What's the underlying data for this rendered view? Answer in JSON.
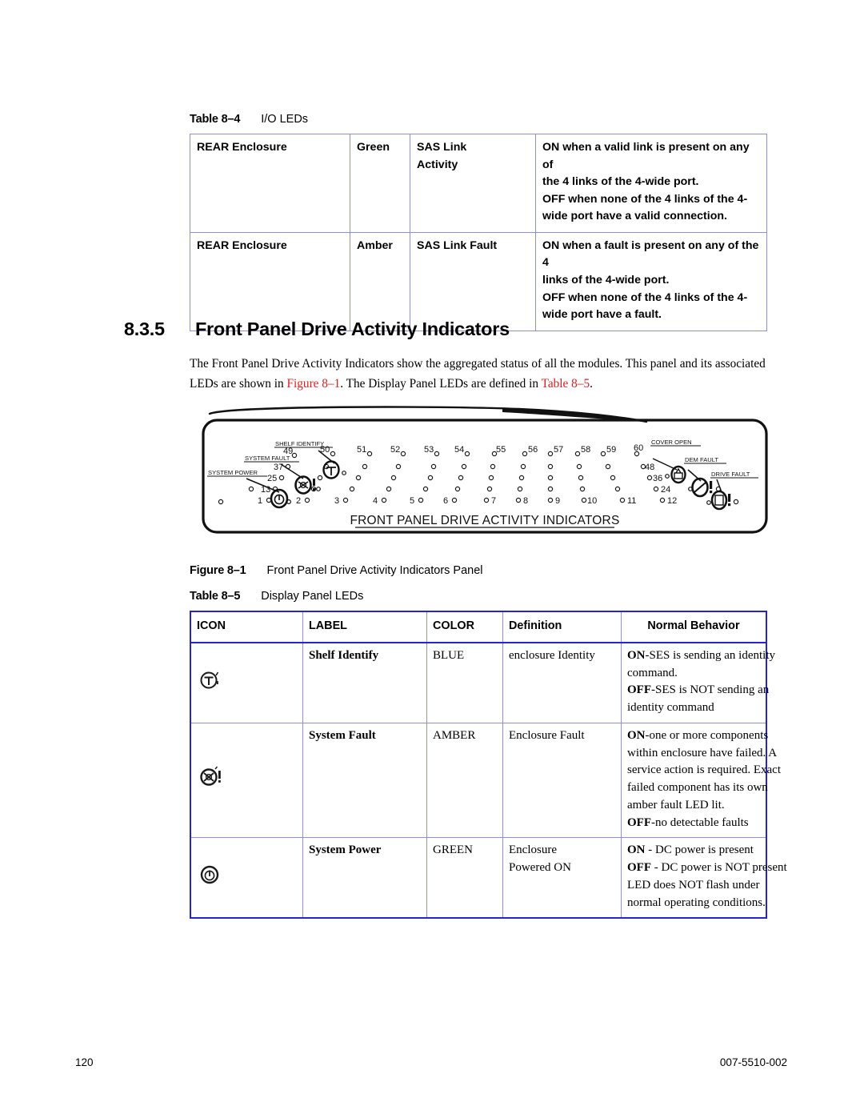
{
  "table_84": {
    "caption_label": "Table 8–4",
    "caption_text": "I/O LEDs",
    "rows": [
      {
        "enclosure": "REAR Enclosure",
        "color": "Green",
        "label_lines": [
          "SAS Link",
          "Activity"
        ],
        "behavior_lines": [
          "ON when a valid link is present on any of",
          "the 4 links of the 4-wide port.",
          "OFF when none of the 4 links of the 4-",
          "wide port have a valid connection."
        ]
      },
      {
        "enclosure": "REAR Enclosure",
        "color": "Amber",
        "label_lines": [
          "SAS Link Fault"
        ],
        "behavior_lines": [
          "ON when a fault is present on any of the 4",
          "links of the 4-wide port.",
          "OFF when none of the 4 links of the 4-",
          "wide port have a fault."
        ]
      }
    ]
  },
  "section": {
    "number": "8.3.5",
    "title": "Front Panel Drive Activity Indicators",
    "paragraph_part1": "The Front  Panel Drive Activity Indicators show the aggregated status of all the modules. This panel and its associated LEDs are shown in ",
    "xref_figure": "Figure 8–1",
    "paragraph_part2": ". The Display Panel LEDs are defined in ",
    "xref_table": "Table 8–5",
    "paragraph_part3": "."
  },
  "figure": {
    "caption_label": "Figure 8–1",
    "caption_text": "Front Panel Drive Activity Indicators Panel",
    "panel_title": "FRONT PANEL DRIVE ACTIVITY INDICATORS",
    "callouts": [
      "SHELF IDENTIFY",
      "SYSTEM FAULT",
      "SYSTEM POWER",
      "COVER OPEN",
      "DEM FAULT",
      "DRIVE FAULT"
    ],
    "bottom_row_numbers": [
      "1",
      "2",
      "3",
      "4",
      "5",
      "6",
      "7",
      "8",
      "9",
      "10",
      "11",
      "12"
    ],
    "row2_numbers": [
      "13",
      "24"
    ],
    "row3_numbers": [
      "25",
      "36"
    ],
    "row4_numbers": [
      "37",
      "48"
    ],
    "top_row_numbers": [
      "49",
      "50",
      "51",
      "52",
      "53",
      "54",
      "55",
      "56",
      "57",
      "58",
      "59",
      "60"
    ]
  },
  "table_85": {
    "caption_label": "Table 8–5",
    "caption_text": "Display Panel LEDs",
    "headers": [
      "ICON",
      "LABEL",
      "COLOR",
      "Definition",
      "Normal Behavior"
    ],
    "rows": [
      {
        "icon_name": "shelf-identify-icon",
        "label": "Shelf Identify",
        "color": "BLUE",
        "definition_lines": [
          "enclosure Identity"
        ],
        "behavior": [
          {
            "strong": "ON",
            "rest": "-SES is sending an identity"
          },
          {
            "strong": "",
            "rest": "command."
          },
          {
            "strong": "OFF",
            "rest": "-SES is NOT sending an"
          },
          {
            "strong": "",
            "rest": "identity command"
          }
        ]
      },
      {
        "icon_name": "system-fault-icon",
        "label": "System Fault",
        "color": "AMBER",
        "definition_lines": [
          "Enclosure Fault"
        ],
        "behavior": [
          {
            "strong": "ON",
            "rest": "-one or more components"
          },
          {
            "strong": "",
            "rest": "within enclosure have failed. A"
          },
          {
            "strong": "",
            "rest": "service action is required. Exact"
          },
          {
            "strong": "",
            "rest": "failed component has its own"
          },
          {
            "strong": "",
            "rest": "amber fault LED lit."
          },
          {
            "strong": "OFF",
            "rest": "-no detectable faults"
          }
        ]
      },
      {
        "icon_name": "system-power-icon",
        "label": "System Power",
        "color": "GREEN",
        "definition_lines": [
          "Enclosure",
          "Powered ON"
        ],
        "behavior": [
          {
            "strong": "ON",
            "rest": " - DC power is present"
          },
          {
            "strong": "OFF",
            "rest": " - DC power is NOT present"
          },
          {
            "strong": "",
            "rest": "LED does NOT flash under"
          },
          {
            "strong": "",
            "rest": "normal operating conditions."
          }
        ]
      }
    ]
  },
  "footer": {
    "page_number": "120",
    "document_number": "007-5510-002"
  },
  "colors": {
    "table_border_light": "#8f8fd8",
    "table_border_strong": "#2323d8",
    "xref_red": "#e02020"
  }
}
